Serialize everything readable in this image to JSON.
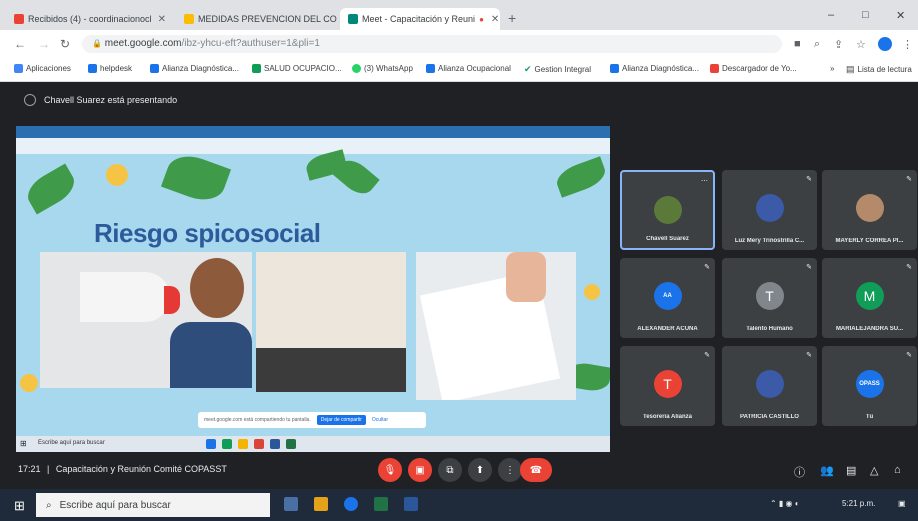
{
  "browser": {
    "tabs": [
      {
        "label": "Recibidos (4) - coordinacionocl",
        "icon": "gmail-icon",
        "active": false
      },
      {
        "label": "MEDIDAS PREVENCION DEL CO",
        "icon": "drive-icon",
        "active": false
      },
      {
        "label": "Meet - Capacitación y Reuni",
        "icon": "meet-icon",
        "active": true
      }
    ],
    "new_tab": "+",
    "window_controls": [
      "–",
      "□",
      "✕"
    ],
    "url_host": "meet.google.com",
    "url_rest": "/ibz-yhcu-eft?authuser=1&pli=1",
    "bookmarks": [
      {
        "label": "Aplicaciones",
        "color": "#4285f4"
      },
      {
        "label": "helpdesk",
        "color": "#1a73e8"
      },
      {
        "label": "Alianza Diagnóstica...",
        "color": "#1a73e8"
      },
      {
        "label": "SALUD OCUPACIO...",
        "color": "#0f9d58"
      },
      {
        "label": "(3) WhatsApp",
        "color": "#25d366"
      },
      {
        "label": "Alianza Ocupacional",
        "color": "#1a73e8"
      },
      {
        "label": "Gestion Integral",
        "color": "#0f9d58"
      },
      {
        "label": "Alianza Diagnóstica...",
        "color": "#1a73e8"
      },
      {
        "label": "Descargador de Yo...",
        "color": "#ea4335"
      }
    ],
    "reading_list": "Lista de lectura"
  },
  "meet": {
    "presenting_text": "Chavell Suarez está presentando",
    "time": "17:21",
    "meeting_title": "Capacitación y Reunión Comité COPASST",
    "slide_title": "Riesgo spicosocial",
    "share_banner": {
      "text": "meet.google.com está compartiendo tu pantalla.",
      "stop": "Dejar de compartir",
      "hide": "Ocultar"
    },
    "share_taskbar_search": "Escribe aquí para buscar",
    "participants": [
      {
        "name": "Chavell Suarez",
        "initial": "",
        "color": "#5b7a3a",
        "active": true
      },
      {
        "name": "Luz Mery Trinostrilla C...",
        "initial": "",
        "color": "#3b5aa8",
        "active": false
      },
      {
        "name": "MAYERLY CORREA PI...",
        "initial": "",
        "color": "#b58a6a",
        "active": false
      },
      {
        "name": "ALEXANDER ACUÑA",
        "initial": "AA",
        "color": "#1a73e8",
        "active": false
      },
      {
        "name": "Talento Humano",
        "initial": "T",
        "color": "#80868b",
        "active": false
      },
      {
        "name": "MARIALEJANDRA SU...",
        "initial": "M",
        "color": "#0f9d58",
        "active": false
      },
      {
        "name": "Tesoreria Alianza",
        "initial": "T",
        "color": "#ea4335",
        "active": false
      },
      {
        "name": "PATRICIA CASTILLO",
        "initial": "",
        "color": "#3b5aa8",
        "active": false
      },
      {
        "name": "Tú",
        "initial": "OPASS",
        "color": "#1a73e8",
        "active": false
      }
    ]
  },
  "taskbar": {
    "search_placeholder": "Escribe aquí para buscar",
    "tray_time": "5:21 p.m."
  }
}
